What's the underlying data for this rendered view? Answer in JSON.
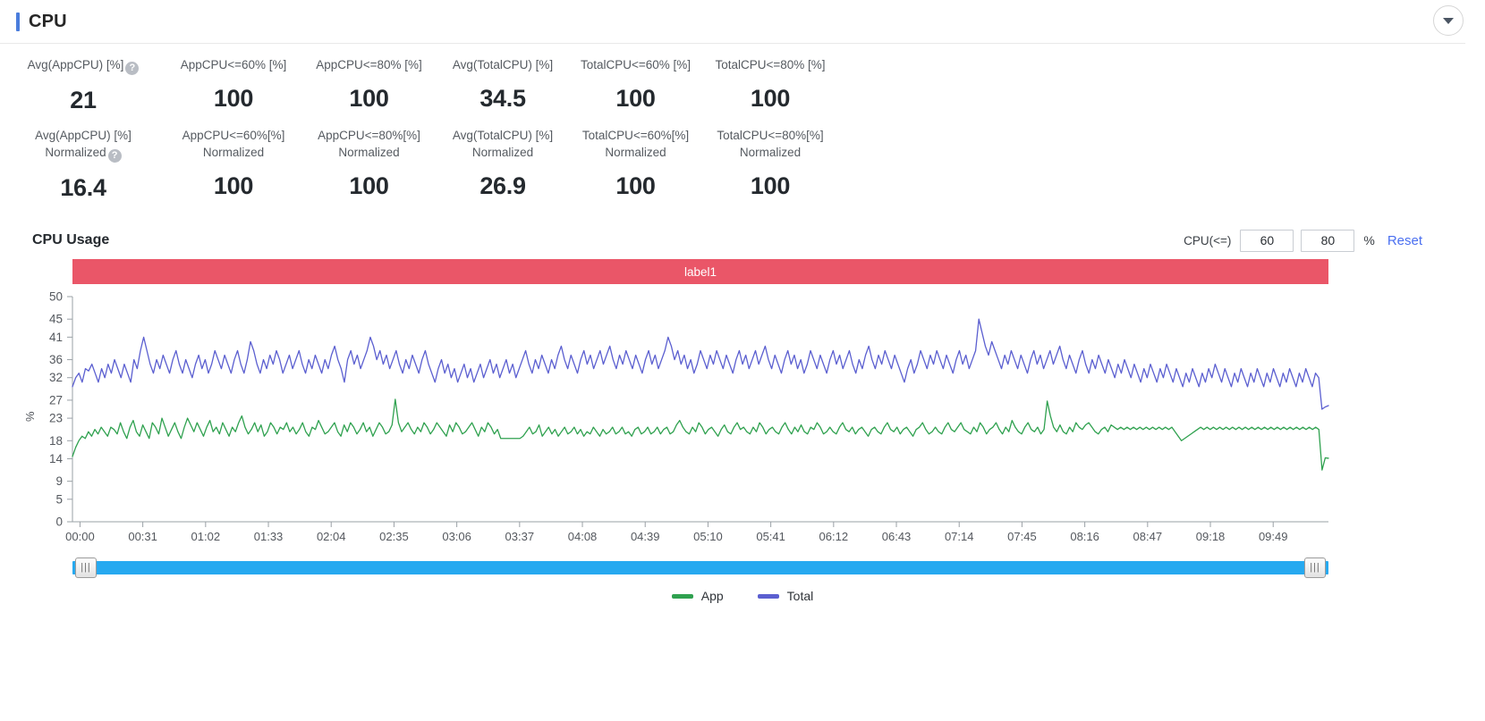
{
  "header": {
    "title": "CPU",
    "accent_color": "#4a7ddc",
    "collapse_icon": "chevron-down-icon"
  },
  "metrics": {
    "row1": [
      {
        "label": "Avg(AppCPU) [%]",
        "sub": "",
        "value": "21",
        "help": true
      },
      {
        "label": "AppCPU<=60% [%]",
        "sub": "",
        "value": "100",
        "help": false
      },
      {
        "label": "AppCPU<=80% [%]",
        "sub": "",
        "value": "100",
        "help": false
      },
      {
        "label": "Avg(TotalCPU) [%]",
        "sub": "",
        "value": "34.5",
        "help": false
      },
      {
        "label": "TotalCPU<=60% [%]",
        "sub": "",
        "value": "100",
        "help": false
      },
      {
        "label": "TotalCPU<=80% [%]",
        "sub": "",
        "value": "100",
        "help": false
      }
    ],
    "row2": [
      {
        "label": "Avg(AppCPU) [%]",
        "sub": "Normalized",
        "value": "16.4",
        "help": true
      },
      {
        "label": "AppCPU<=60%[%]",
        "sub": "Normalized",
        "value": "100",
        "help": false
      },
      {
        "label": "AppCPU<=80%[%]",
        "sub": "Normalized",
        "value": "100",
        "help": false
      },
      {
        "label": "Avg(TotalCPU) [%]",
        "sub": "Normalized",
        "value": "26.9",
        "help": false
      },
      {
        "label": "TotalCPU<=60%[%]",
        "sub": "Normalized",
        "value": "100",
        "help": false
      },
      {
        "label": "TotalCPU<=80%[%]",
        "sub": "Normalized",
        "value": "100",
        "help": false
      }
    ],
    "help_glyph": "?"
  },
  "usage": {
    "title": "CPU Usage",
    "threshold_label": "CPU(<=)",
    "threshold_low": "60",
    "threshold_high": "80",
    "percent_sign": "%",
    "reset_label": "Reset"
  },
  "label_band": {
    "text": "label1",
    "color": "#ea5668"
  },
  "scrollbar": {
    "track_color": "#26a9f0",
    "left_handle": "|||",
    "right_handle": "|||"
  },
  "legend": [
    {
      "name": "App",
      "color": "#2fa14f"
    },
    {
      "name": "Total",
      "color": "#5b5fd0"
    }
  ],
  "chart_data": {
    "type": "line",
    "title": "CPU Usage",
    "xlabel": "",
    "ylabel": "%",
    "ylim": [
      0,
      50
    ],
    "grid": false,
    "legend_position": "bottom",
    "ytick_labels": [
      "0",
      "5",
      "9",
      "14",
      "18",
      "23",
      "27",
      "32",
      "36",
      "41",
      "45",
      "50"
    ],
    "ytick_values": [
      0,
      5,
      9,
      14,
      18,
      23,
      27,
      32,
      36,
      41,
      45,
      50
    ],
    "xtick_labels": [
      "00:00",
      "00:31",
      "01:02",
      "01:33",
      "02:04",
      "02:35",
      "03:06",
      "03:37",
      "04:08",
      "04:39",
      "05:10",
      "05:41",
      "06:12",
      "06:43",
      "07:14",
      "07:45",
      "08:16",
      "08:47",
      "09:18",
      "09:49"
    ],
    "series": [
      {
        "name": "App",
        "color": "#2fa14f",
        "values": [
          14.5,
          16.5,
          18,
          19,
          18.5,
          20,
          19,
          20.5,
          19.5,
          21,
          20,
          19,
          21,
          20.5,
          19.5,
          22,
          20,
          18.5,
          21,
          22.5,
          20,
          19,
          21.5,
          20,
          18.5,
          22,
          21,
          19.5,
          23,
          21,
          19,
          20.5,
          22,
          20,
          18.5,
          21,
          23,
          21.5,
          20,
          22,
          20.5,
          19,
          21,
          22.5,
          20,
          21,
          19.5,
          22,
          20.5,
          19,
          21,
          20,
          22,
          23.5,
          21,
          19.5,
          20.5,
          22,
          20,
          21.5,
          19,
          20,
          22,
          21,
          19.5,
          21,
          20.5,
          22,
          20,
          21,
          19.5,
          20.5,
          22,
          20,
          19,
          21,
          20.5,
          22.5,
          21,
          19.5,
          20,
          21,
          22,
          20,
          19,
          21.5,
          20,
          22,
          21,
          19.5,
          20.5,
          22,
          20,
          21,
          19,
          20.5,
          22,
          21,
          19.5,
          20,
          21.5,
          27.2,
          22,
          20,
          21,
          22,
          20.5,
          19.5,
          21,
          20,
          22,
          21,
          19.5,
          20.5,
          22,
          21,
          20,
          19,
          21.5,
          20,
          22,
          21,
          19.5,
          20,
          21,
          22,
          20.5,
          19,
          21,
          20,
          22,
          21,
          19.5,
          20.5,
          18.5,
          18.5,
          18.5,
          18.5,
          18.5,
          18.5,
          18.5,
          19,
          20,
          21,
          19.5,
          20,
          21.5,
          19,
          20,
          21,
          19.5,
          20.5,
          19,
          20,
          21,
          19.5,
          20,
          21,
          19.5,
          20.5,
          19,
          20,
          19.5,
          21,
          20,
          19,
          20.5,
          19.5,
          20,
          21,
          19.5,
          20,
          21,
          19.5,
          20,
          19,
          20.5,
          21,
          19.5,
          20,
          21,
          19.5,
          20,
          21,
          19.5,
          20.5,
          21,
          19.5,
          20,
          21.5,
          22.5,
          21,
          20,
          19.5,
          21,
          20,
          22,
          21,
          19.5,
          20.5,
          21,
          20,
          19,
          20.5,
          21.5,
          20,
          19.5,
          21,
          22,
          20.5,
          21,
          20,
          19.5,
          21,
          20,
          22,
          21,
          19.5,
          20.5,
          21,
          20,
          19.5,
          21,
          22,
          20.5,
          19.5,
          21,
          20,
          21.5,
          20,
          19.5,
          21,
          20.5,
          22,
          21,
          19.5,
          20,
          21,
          20,
          19.5,
          21,
          22,
          20.5,
          20,
          21,
          19.5,
          20.5,
          21,
          20,
          19,
          20.5,
          21,
          20,
          19.5,
          21,
          22,
          20.5,
          20,
          21,
          19.5,
          20.5,
          21,
          20,
          19,
          20.5,
          21,
          22,
          20.5,
          19.5,
          20,
          21,
          20,
          19.5,
          21,
          22,
          20.5,
          20,
          21,
          22,
          20.5,
          20,
          19.5,
          21,
          20,
          22,
          21,
          19.5,
          20.5,
          21,
          22,
          20.5,
          19.5,
          21,
          20,
          22.5,
          21,
          20,
          19.5,
          21,
          22,
          20.5,
          20,
          21,
          19.5,
          20.5,
          26.8,
          23.5,
          21,
          20,
          21.5,
          20,
          19.5,
          21,
          20,
          22,
          21,
          20.5,
          21.5,
          22,
          21,
          20,
          19.5,
          20.5,
          21,
          20,
          21.5,
          21,
          20.5,
          21,
          20.5,
          21,
          20.5,
          21,
          20.5,
          21,
          20.5,
          21,
          20.5,
          21,
          20.5,
          21,
          20.5,
          21,
          20.5,
          21,
          20,
          19,
          18,
          18.5,
          19,
          19.5,
          20,
          20.5,
          21,
          20.5,
          21,
          20.5,
          21,
          20.5,
          21,
          20.5,
          21,
          20.5,
          21,
          20.5,
          21,
          20.5,
          21,
          20.5,
          21,
          20.5,
          21,
          20.5,
          21,
          20.5,
          21,
          20.5,
          21,
          20.5,
          21,
          20.5,
          21,
          20.5,
          21,
          20.5,
          21,
          20.5,
          21,
          20.5,
          21,
          20.5,
          11.5,
          14.2,
          14.1
        ]
      },
      {
        "name": "Total",
        "color": "#5b5fd0",
        "values": [
          30,
          32,
          33,
          31,
          34,
          33.5,
          35,
          33,
          31,
          34,
          32,
          35,
          33,
          36,
          34,
          32,
          35,
          33,
          31,
          36,
          34,
          38,
          41,
          38,
          35,
          33,
          36,
          34,
          37,
          35,
          33,
          36,
          38,
          35,
          33,
          36,
          34,
          32,
          35,
          37,
          34,
          36,
          33,
          35,
          38,
          36,
          34,
          37,
          35,
          33,
          36,
          38,
          35,
          33,
          36,
          40,
          38,
          35,
          33,
          36,
          34,
          37,
          35,
          38,
          36,
          33,
          35,
          37,
          34,
          36,
          38,
          35,
          33,
          36,
          34,
          37,
          35,
          33,
          36,
          34,
          37,
          39,
          36,
          34,
          31,
          36,
          38,
          35,
          37,
          34,
          36,
          38,
          41,
          39,
          36,
          38,
          35,
          37,
          34,
          36,
          38,
          35,
          33,
          36,
          34,
          37,
          35,
          33,
          36,
          38,
          35,
          33,
          31,
          34,
          36,
          33,
          35,
          32,
          34,
          31,
          33,
          35,
          32,
          34,
          31,
          33,
          35,
          32,
          34,
          36,
          33,
          35,
          32,
          34,
          36,
          33,
          35,
          32,
          34,
          36,
          38,
          35,
          33,
          36,
          34,
          37,
          35,
          33,
          36,
          34,
          37,
          39,
          36,
          34,
          37,
          35,
          33,
          36,
          38,
          35,
          37,
          34,
          36,
          38,
          35,
          37,
          39,
          36,
          34,
          37,
          35,
          38,
          36,
          34,
          37,
          35,
          33,
          36,
          38,
          35,
          37,
          34,
          36,
          38,
          41,
          39,
          36,
          38,
          35,
          37,
          34,
          36,
          33,
          35,
          38,
          36,
          34,
          37,
          35,
          38,
          36,
          34,
          37,
          35,
          33,
          36,
          38,
          35,
          37,
          34,
          36,
          38,
          35,
          37,
          39,
          36,
          34,
          37,
          35,
          33,
          36,
          38,
          35,
          37,
          34,
          36,
          33,
          35,
          38,
          36,
          34,
          37,
          35,
          33,
          36,
          38,
          35,
          37,
          34,
          36,
          38,
          35,
          33,
          36,
          34,
          37,
          39,
          36,
          34,
          37,
          35,
          38,
          36,
          34,
          37,
          35,
          33,
          31,
          34,
          36,
          33,
          35,
          38,
          36,
          34,
          37,
          35,
          38,
          36,
          34,
          37,
          35,
          33,
          36,
          38,
          35,
          37,
          34,
          36,
          38,
          45,
          42,
          39,
          37,
          40,
          38,
          36,
          34,
          37,
          35,
          38,
          36,
          34,
          37,
          35,
          33,
          36,
          38,
          35,
          37,
          34,
          36,
          38,
          35,
          37,
          39,
          36,
          34,
          37,
          35,
          33,
          36,
          38,
          35,
          33,
          36,
          34,
          37,
          35,
          33,
          36,
          34,
          32,
          35,
          33,
          36,
          34,
          32,
          35,
          33,
          31,
          34,
          32,
          35,
          33,
          31,
          34,
          32,
          35,
          33,
          31,
          34,
          32,
          30,
          33,
          31,
          34,
          32,
          30,
          33,
          31,
          34,
          32,
          35,
          33,
          31,
          34,
          32,
          30,
          33,
          31,
          34,
          32,
          30,
          33,
          31,
          34,
          32,
          30,
          33,
          31,
          34,
          32,
          30,
          33,
          31,
          34,
          32,
          30,
          33,
          31,
          34,
          32,
          30,
          33,
          32,
          25,
          25.5,
          25.8
        ]
      }
    ]
  }
}
